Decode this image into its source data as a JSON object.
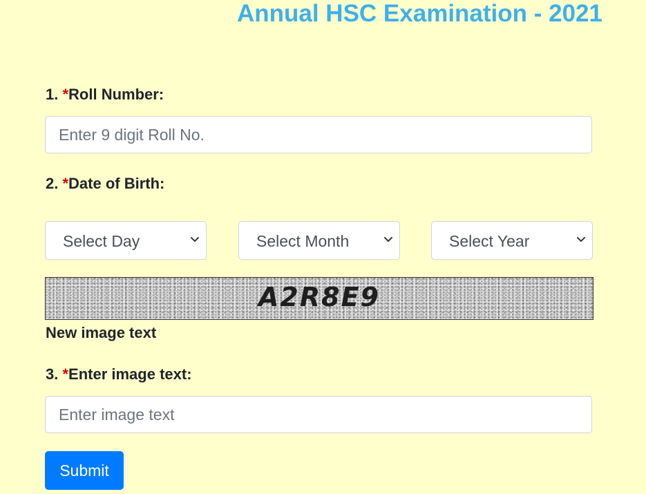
{
  "header": {
    "title": "Annual HSC Examination - 2021"
  },
  "form": {
    "roll": {
      "number": "1. ",
      "required_mark": "*",
      "label": "Roll Number:",
      "placeholder": "Enter 9 digit Roll No.",
      "value": ""
    },
    "dob": {
      "number": "2. ",
      "required_mark": "*",
      "label": "Date of Birth:",
      "day": {
        "selected": "Select Day"
      },
      "month": {
        "selected": "Select Month"
      },
      "year": {
        "selected": "Select Year"
      }
    },
    "captcha": {
      "image_text": "A2R8E9",
      "refresh_label": "New image text"
    },
    "image_text": {
      "number": "3. ",
      "required_mark": "*",
      "label": "Enter image text:",
      "placeholder": "Enter image text",
      "value": ""
    },
    "submit_label": "Submit"
  },
  "colors": {
    "background": "#ffffcc",
    "title": "#3fb0ea",
    "required": "#dc0000",
    "primary": "#007bff"
  }
}
